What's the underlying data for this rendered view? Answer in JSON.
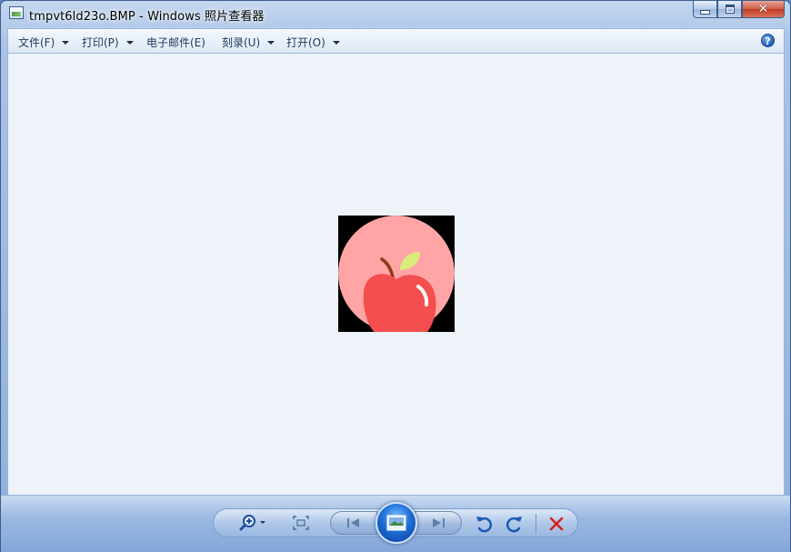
{
  "window": {
    "title": "tmpvt6ld23o.BMP - Windows 照片查看器",
    "app_icon": "photo-viewer-icon",
    "caption_buttons": {
      "minimize_icon": "minimize-icon",
      "maximize_icon": "maximize-icon",
      "close_icon": "close-icon"
    }
  },
  "menubar": {
    "items": [
      {
        "label": "文件(F)",
        "has_dropdown": true
      },
      {
        "label": "打印(P)",
        "has_dropdown": true
      },
      {
        "label": "电子邮件(E)",
        "has_dropdown": false
      },
      {
        "label": "刻录(U)",
        "has_dropdown": true
      },
      {
        "label": "打开(O)",
        "has_dropdown": true
      }
    ],
    "help_icon": "help-icon",
    "help_glyph": "?"
  },
  "viewer": {
    "image_content": "apple-icon",
    "background_color": "#eef3fa"
  },
  "toolbar": {
    "buttons": [
      "zoom-icon",
      "fit-to-window-icon",
      "previous-icon",
      "slideshow-icon",
      "next-icon",
      "rotate-counterclockwise-icon",
      "rotate-clockwise-icon",
      "delete-icon"
    ]
  },
  "colors": {
    "apple_circle": "#ffa5a5",
    "apple_body": "#f44f4f",
    "leaf": "#d8ec7a",
    "stem": "#8a3b1d",
    "delete_red": "#d81e1e",
    "accent_blue": "#1e6ed8"
  }
}
